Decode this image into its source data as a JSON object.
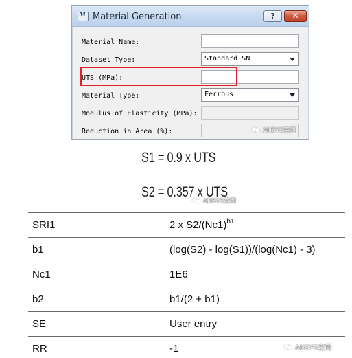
{
  "dialog": {
    "title": "Material Generation",
    "help_label": "?",
    "close_label": "✕",
    "fields": {
      "material_name_label": "Material Name:",
      "material_name_value": "",
      "dataset_type_label": "Dataset Type:",
      "dataset_type_value": "Standard SN",
      "uts_label": "UTS (MPa):",
      "uts_value": "",
      "material_type_label": "Material Type:",
      "material_type_value": "Ferrous",
      "modulus_label": "Modulus of Elasticity (MPa):",
      "modulus_value": "",
      "reduction_label": "Reduction in Area (%):",
      "reduction_value": ""
    },
    "highlight_color": "#e0202a"
  },
  "formulas": {
    "s1": "S1 = 0.9 x UTS",
    "s2": "S2 = 0.357 x UTS"
  },
  "table": {
    "rows": [
      {
        "name": "SRI1",
        "formula": "2 x S2/(Nc1)",
        "sup": "b1"
      },
      {
        "name": "b1",
        "formula": "(log(S2) - log(S1))/(log(Nc1) - 3)",
        "sup": ""
      },
      {
        "name": "Nc1",
        "formula": "1E6",
        "sup": ""
      },
      {
        "name": "b2",
        "formula": "b1/(2 + b1)",
        "sup": ""
      },
      {
        "name": "SE",
        "formula": "User entry",
        "sup": ""
      },
      {
        "name": "RR",
        "formula": "-1",
        "sup": ""
      }
    ]
  },
  "watermarks": {
    "text": "ANSYS空间",
    "icon": "wechat-icon"
  }
}
